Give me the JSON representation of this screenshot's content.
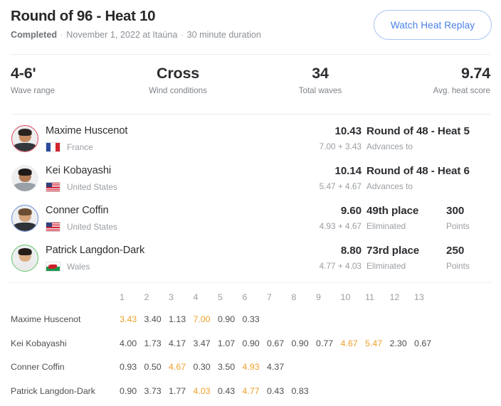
{
  "header": {
    "title": "Round of 96 - Heat 10",
    "status": "Completed",
    "separator": "·",
    "date": "November 1, 2022 at Itaúna",
    "duration": "30 minute duration",
    "replay_button": "Watch Heat Replay",
    "accent_color": "#4a7fe8",
    "border_color": "#a9c4f2"
  },
  "stats": [
    {
      "value": "4-6'",
      "label": "Wave range"
    },
    {
      "value": "Cross",
      "label": "Wind conditions"
    },
    {
      "value": "34",
      "label": "Total waves"
    },
    {
      "value": "9.74",
      "label": "Avg. heat score"
    }
  ],
  "athletes": [
    {
      "name": "Maxime Huscenot",
      "country": "France",
      "flag": "flag-france-icon",
      "jersey_color": "#e04a5f",
      "skin": "#c68a63",
      "hair": "#2a2420",
      "shirt": "#34373c",
      "score": "10.43",
      "score_parts": "7.00 + 3.43",
      "outcome": "Round of 48 - Heat 5",
      "outcome_sub": "Advances to",
      "points": "",
      "points_label": ""
    },
    {
      "name": "Kei Kobayashi",
      "country": "United States",
      "flag": "flag-usa-icon",
      "jersey_color": "#f0f0f2",
      "skin": "#b07a55",
      "hair": "#201b18",
      "shirt": "#9aa0a7",
      "score": "10.14",
      "score_parts": "5.47 + 4.67",
      "outcome": "Round of 48 - Heat 6",
      "outcome_sub": "Advances to",
      "points": "",
      "points_label": ""
    },
    {
      "name": "Conner Coffin",
      "country": "United States",
      "flag": "flag-usa-icon",
      "jersey_color": "#6f8fd8",
      "skin": "#d2a279",
      "hair": "#6b4d33",
      "shirt": "#2f3237",
      "score": "9.60",
      "score_parts": "4.93 + 4.67",
      "outcome": "49th place",
      "outcome_sub": "Eliminated",
      "points": "300",
      "points_label": "Points"
    },
    {
      "name": "Patrick Langdon-Dark",
      "country": "Wales",
      "flag": "flag-wales-icon",
      "jersey_color": "#63c468",
      "skin": "#dcae86",
      "hair": "#241d18",
      "shirt": "#eaeaec",
      "score": "8.80",
      "score_parts": "4.77 + 4.03",
      "outcome": "73rd place",
      "outcome_sub": "Eliminated",
      "points": "250",
      "points_label": "Points"
    }
  ],
  "wave_table": {
    "columns": [
      "1",
      "2",
      "3",
      "4",
      "5",
      "6",
      "7",
      "8",
      "9",
      "10",
      "11",
      "12",
      "13"
    ],
    "highlight_color": "#f0a02a",
    "rows": [
      {
        "label": "Maxime Huscenot",
        "waves": [
          "3.43",
          "3.40",
          "1.13",
          "7.00",
          "0.90",
          "0.33"
        ],
        "highlights": [
          0,
          3
        ]
      },
      {
        "label": "Kei Kobayashi",
        "waves": [
          "4.00",
          "1.73",
          "4.17",
          "3.47",
          "1.07",
          "0.90",
          "0.67",
          "0.90",
          "0.77",
          "4.67",
          "5.47",
          "2.30",
          "0.67"
        ],
        "highlights": [
          9,
          10
        ]
      },
      {
        "label": "Conner Coffin",
        "waves": [
          "0.93",
          "0.50",
          "4.67",
          "0.30",
          "3.50",
          "4.93",
          "4.37"
        ],
        "highlights": [
          2,
          5
        ]
      },
      {
        "label": "Patrick Langdon-Dark",
        "waves": [
          "0.90",
          "3.73",
          "1.77",
          "4.03",
          "0.43",
          "4.77",
          "0.43",
          "0.83"
        ],
        "highlights": [
          3,
          5
        ]
      }
    ]
  }
}
